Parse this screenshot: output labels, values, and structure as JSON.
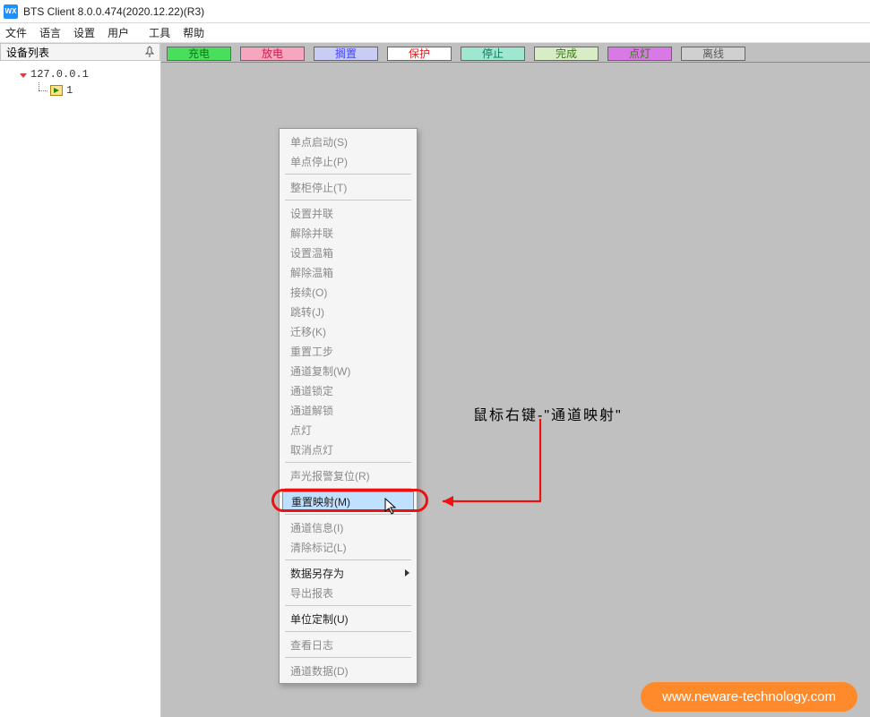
{
  "titlebar": {
    "app_icon_text": "WX",
    "title": "BTS Client 8.0.0.474(2020.12.22)(R3)"
  },
  "menubar": {
    "items": [
      "文件",
      "语言",
      "设置",
      "用户",
      "工具",
      "帮助"
    ]
  },
  "sidebar": {
    "header": "设备列表",
    "root_label": "127.0.0.1",
    "leaf_label": "1"
  },
  "status_strip": {
    "buttons": [
      {
        "label": "充电",
        "bg": "#4ade5d",
        "fg": "#0a7a14"
      },
      {
        "label": "放电",
        "bg": "#f7a6c0",
        "fg": "#d11c4b"
      },
      {
        "label": "搁置",
        "bg": "#c9cdf4",
        "fg": "#4040ff"
      },
      {
        "label": "保护",
        "bg": "#ffffff",
        "fg": "#e02020"
      },
      {
        "label": "停止",
        "bg": "#9fe7d0",
        "fg": "#0c7a5c"
      },
      {
        "label": "完成",
        "bg": "#d8ecc5",
        "fg": "#3a7a1a"
      },
      {
        "label": "点灯",
        "bg": "#d979e6",
        "fg": "#3a7a1a"
      },
      {
        "label": "离线",
        "bg": "#d0d0d0",
        "fg": "#5a5a5a"
      }
    ]
  },
  "context_menu": {
    "groups": [
      [
        {
          "label": "单点启动(S)",
          "enabled": false
        },
        {
          "label": "单点停止(P)",
          "enabled": false
        }
      ],
      [
        {
          "label": "整柜停止(T)",
          "enabled": false
        }
      ],
      [
        {
          "label": "设置并联",
          "enabled": false
        },
        {
          "label": "解除并联",
          "enabled": false
        },
        {
          "label": "设置温箱",
          "enabled": false
        },
        {
          "label": "解除温箱",
          "enabled": false
        },
        {
          "label": "接续(O)",
          "enabled": false
        },
        {
          "label": "跳转(J)",
          "enabled": false
        },
        {
          "label": "迁移(K)",
          "enabled": false
        },
        {
          "label": "重置工步",
          "enabled": false
        },
        {
          "label": "通道复制(W)",
          "enabled": false
        },
        {
          "label": "通道锁定",
          "enabled": false
        },
        {
          "label": "通道解锁",
          "enabled": false
        },
        {
          "label": "点灯",
          "enabled": false
        },
        {
          "label": "取消点灯",
          "enabled": false
        }
      ],
      [
        {
          "label": "声光报警复位(R)",
          "enabled": false
        }
      ],
      [
        {
          "label": "重置映射(M)",
          "enabled": true,
          "selected": true
        }
      ],
      [
        {
          "label": "通道信息(I)",
          "enabled": false
        },
        {
          "label": "清除标记(L)",
          "enabled": false
        }
      ],
      [
        {
          "label": "数据另存为",
          "enabled": true,
          "submenu": true
        },
        {
          "label": "导出报表",
          "enabled": false
        }
      ],
      [
        {
          "label": "单位定制(U)",
          "enabled": true
        }
      ],
      [
        {
          "label": "查看日志",
          "enabled": false
        }
      ],
      [
        {
          "label": "通道数据(D)",
          "enabled": false
        }
      ]
    ]
  },
  "annotation": {
    "text": "鼠标右键-\"通道映射\""
  },
  "watermark": {
    "text": "www.neware-technology.com"
  }
}
